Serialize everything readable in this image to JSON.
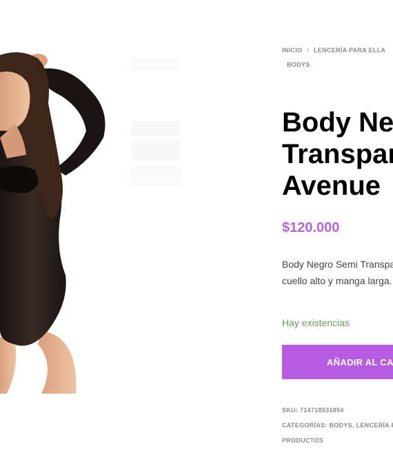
{
  "breadcrumb": {
    "items": [
      "INICIO",
      "LENCERÍA PARA ELLA",
      "BODYS"
    ],
    "separator": "/"
  },
  "product": {
    "title_lines": [
      "Body Negro Semi",
      "Transparente",
      "Avenue"
    ],
    "price": "$120.000",
    "description_lines": [
      "Body Negro Semi Transparente de",
      "cuello alto y manga larga."
    ],
    "stock": "Hay existencias",
    "add_to_cart": "AÑADIR AL CARRITO",
    "sku_label": "SKU:",
    "sku": "714718531854",
    "categories_label": "CATEGORÍAS:",
    "categories": [
      "BODYS",
      "LENCERÍA PARA ELLA"
    ],
    "categories_tail": "PRODUCTOS"
  },
  "colors": {
    "accent": "#b75be3",
    "price": "#b565d9",
    "stock": "#6b9a5a"
  },
  "icons": {
    "product_image": "product-photo"
  }
}
